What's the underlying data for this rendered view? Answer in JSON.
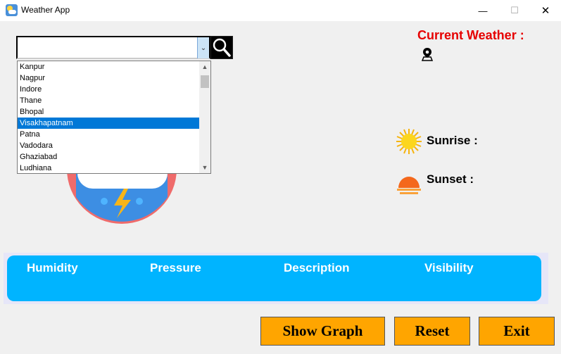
{
  "window": {
    "title": "Weather App",
    "controls": {
      "minimize": "—",
      "maximize": "☐",
      "close": "✕"
    }
  },
  "search": {
    "value": "",
    "arrow": "⌄",
    "dropdown": {
      "items": [
        "Kanpur",
        "Nagpur",
        "Indore",
        "Thane",
        "Bhopal",
        "Visakhapatnam",
        "Patna",
        "Vadodara",
        "Ghaziabad",
        "Ludhiana"
      ],
      "selected": "Visakhapatnam",
      "scroll_up": "▲",
      "scroll_down": "▼"
    }
  },
  "current_weather": {
    "label": "Current Weather :"
  },
  "sun": {
    "sunrise_label": "Sunrise :",
    "sunset_label": "Sunset :"
  },
  "info": {
    "humidity_label": "Humidity",
    "pressure_label": "Pressure",
    "description_label": "Description",
    "visibility_label": "Visibility"
  },
  "buttons": {
    "show_graph": "Show Graph",
    "reset": "Reset",
    "exit": "Exit"
  },
  "colors": {
    "title_red": "#e60000",
    "panel_blue": "#00b4ff",
    "button_orange": "#ffa500",
    "selection_blue": "#0078d7"
  },
  "icons": [
    "app-icon",
    "search-icon",
    "location-pin-icon",
    "sunrise-icon",
    "sunset-icon",
    "weather-logo"
  ]
}
